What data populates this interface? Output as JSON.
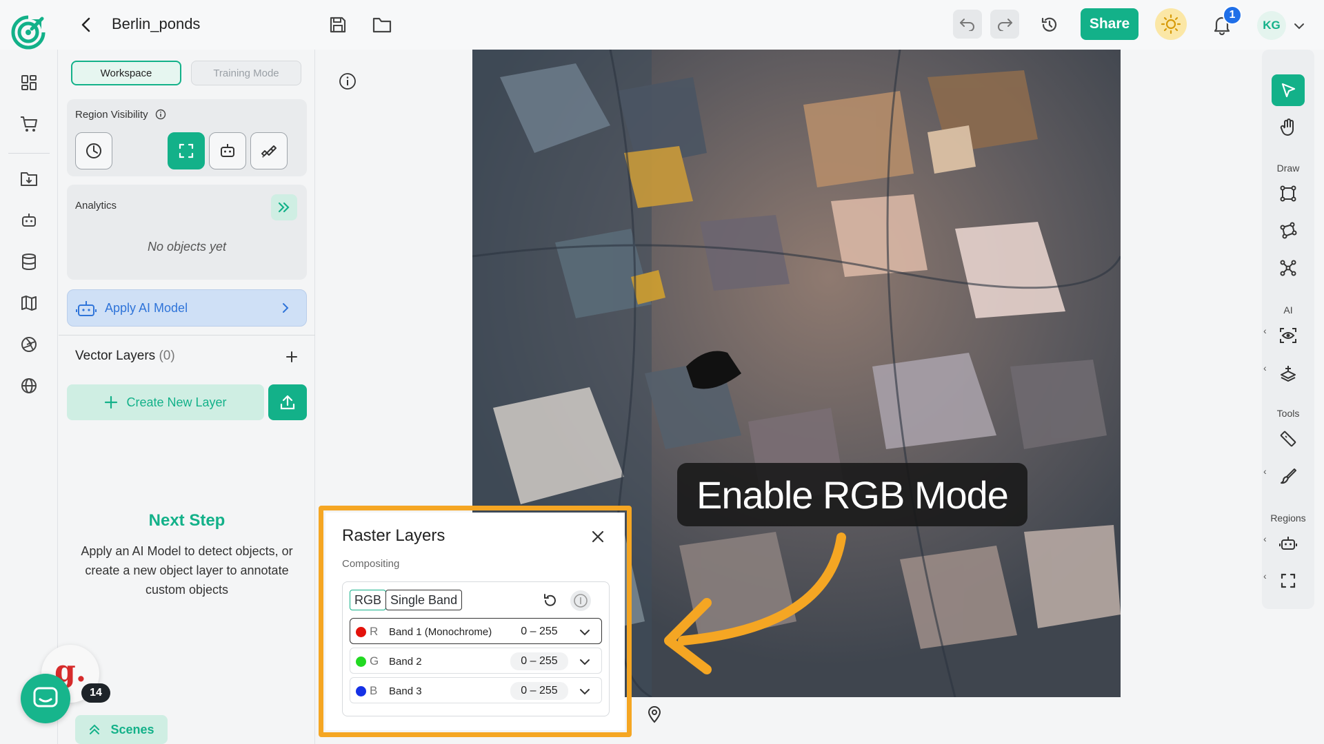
{
  "header": {
    "project_title": "Berlin_ponds",
    "share_label": "Share",
    "notification_count": "1",
    "avatar_initials": "KG"
  },
  "panel": {
    "mode_tabs": [
      "Workspace",
      "Training Mode"
    ],
    "region_visibility": {
      "title": "Region Visibility"
    },
    "analytics": {
      "title": "Analytics",
      "empty_text": "No objects yet"
    },
    "apply_ai_label": "Apply AI Model",
    "vector_layers": {
      "title": "Vector Layers",
      "count": "(0)"
    },
    "create_layer_label": "Create New Layer",
    "next_step": {
      "title": "Next Step",
      "body": "Apply an AI Model to detect objects, or create a new object layer to annotate custom objects"
    },
    "scenes_label": "Scenes"
  },
  "chat": {
    "badge_count": "14",
    "brand_letter": "g."
  },
  "callout_text": "Enable RGB Mode",
  "raster": {
    "title": "Raster Layers",
    "subtitle": "Compositing",
    "modes": [
      "RGB",
      "Single Band"
    ],
    "bands": [
      {
        "letter": "R",
        "name": "Band 1 (Monochrome)",
        "range": "0 – 255",
        "color": "#e3120b"
      },
      {
        "letter": "G",
        "name": "Band 2",
        "range": "0 – 255",
        "color": "#22d922"
      },
      {
        "letter": "B",
        "name": "Band 3",
        "range": "0 – 255",
        "color": "#1531e6"
      }
    ]
  },
  "right_toolbar": {
    "sections": [
      "Draw",
      "AI",
      "Tools",
      "Regions"
    ]
  },
  "colors": {
    "accent": "#13b189",
    "highlight": "#f5a623",
    "link_blue": "#2f74d9"
  }
}
